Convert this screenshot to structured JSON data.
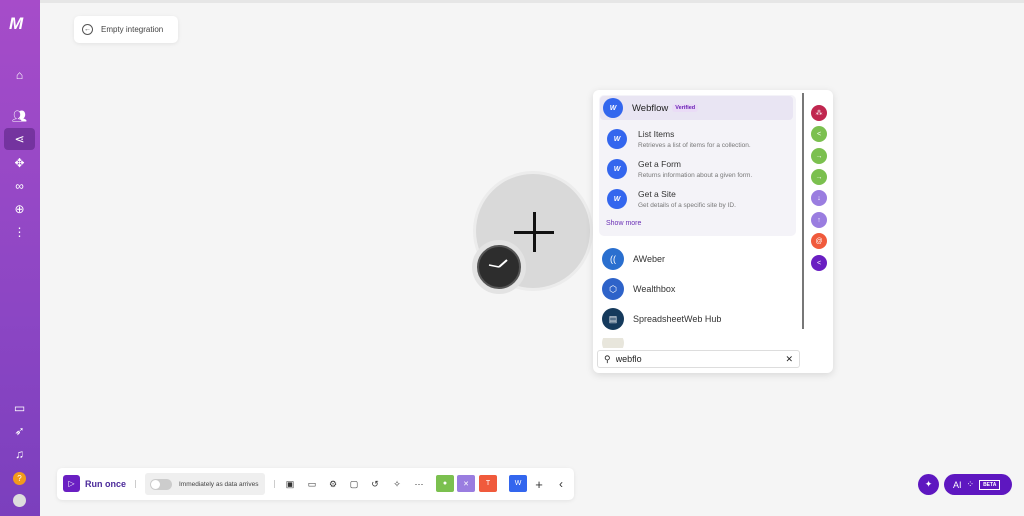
{
  "sidebar": {
    "logo": "M"
  },
  "header": {
    "back_label": "Empty integration"
  },
  "search": {
    "value": "webflo"
  },
  "module_list": {
    "webflow": {
      "name": "Webflow",
      "badge": "Verified",
      "actions": [
        {
          "title": "List Items",
          "desc": "Retrieves a list of items for a collection."
        },
        {
          "title": "Get a Form",
          "desc": "Returns information about a given form."
        },
        {
          "title": "Get a Site",
          "desc": "Get details of a specific site by ID."
        }
      ],
      "show_more": "Show more"
    },
    "apps": [
      {
        "name": "AWeber",
        "color": "#2a6fcf"
      },
      {
        "name": "Wealthbox",
        "color": "#2e63c9"
      },
      {
        "name": "SpreadsheetWeb Hub",
        "color": "#153a5c"
      }
    ]
  },
  "rail_colors": [
    "#c0264f",
    "#7bc04f",
    "#7bc04f",
    "#7bc04f",
    "#9a7de0",
    "#9a7de0",
    "#f05a3c",
    "#6a1fc2"
  ],
  "toolbar": {
    "run_label": "Run once",
    "schedule_label": "Immediately as data arrives"
  },
  "ai": {
    "label": "AI",
    "beta": "BETA"
  }
}
